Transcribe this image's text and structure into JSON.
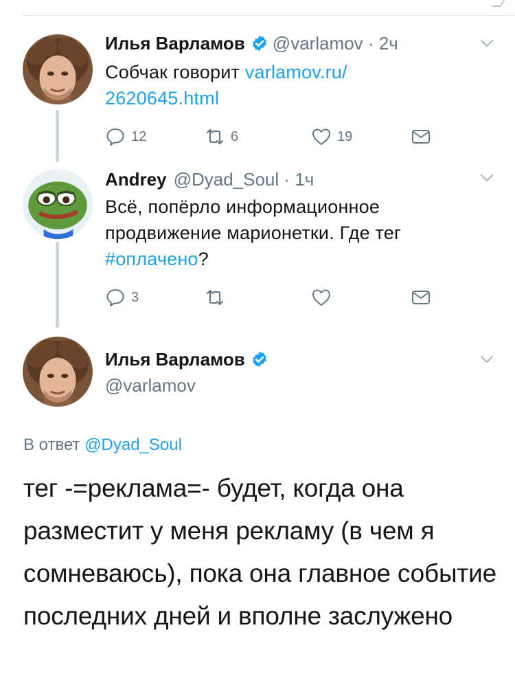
{
  "theme": {
    "link": "#1da1f2",
    "muted": "#657786",
    "text": "#14171a",
    "verified": "#1da1f2"
  },
  "tweets": [
    {
      "name": "Илья Варламов",
      "verified": true,
      "handle": "@varlamov",
      "time": "2ч",
      "text_before": "Собчак говорит ",
      "link": "varlamov.ru/\n2620645.html",
      "replies": "12",
      "retweets": "6",
      "likes": "19"
    },
    {
      "name": "Andrey",
      "verified": false,
      "handle": "@Dyad_Soul",
      "time": "1ч",
      "text_before": "Всё, попёрло информационное продвижение марионетки. Где тег ",
      "hashtag": "#оплачено",
      "text_after": "?",
      "replies": "3",
      "retweets": "",
      "likes": ""
    }
  ],
  "main_tweet": {
    "name": "Илья Варламов",
    "verified": true,
    "handle": "@varlamov",
    "reply_prefix": "В ответ ",
    "reply_handle": "@Dyad_Soul",
    "text": "тег -=реклама=- будет, когда она разместит у меня рекламу (в чем я сомневаюсь), пока она главное событие последних дней и вполне заслужено"
  },
  "icons": [
    "reply-icon",
    "retweet-icon",
    "like-icon",
    "direct-message-icon",
    "verified-badge-icon",
    "chevron-down-icon"
  ],
  "separator": "·"
}
